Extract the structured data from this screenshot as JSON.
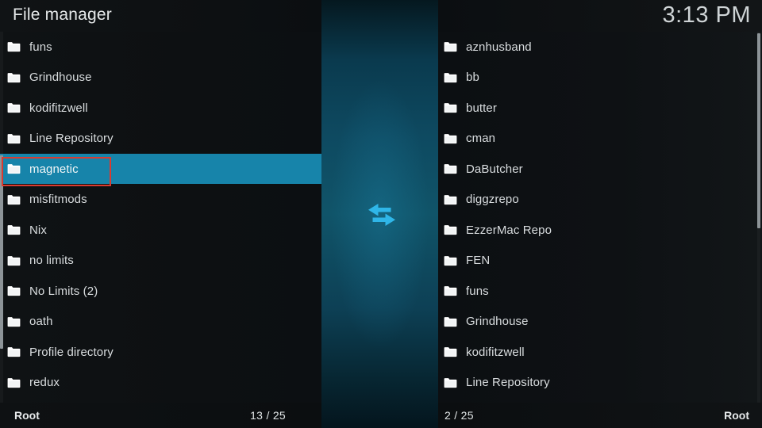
{
  "header": {
    "title": "File manager",
    "clock": "3:13 PM"
  },
  "center": {
    "transfer_icon": "swap-horizontal-arrows-icon",
    "accent_color": "#2eb4e6"
  },
  "theme": {
    "selection_color": "#1784aa",
    "annotation_color": "#d93b30",
    "text_color": "#d9dddf",
    "panel_background": "#0d1012"
  },
  "left_panel": {
    "selected_index": 4,
    "items": [
      {
        "label": "funs",
        "icon": "folder-icon"
      },
      {
        "label": "Grindhouse",
        "icon": "folder-icon"
      },
      {
        "label": "kodifitzwell",
        "icon": "folder-icon"
      },
      {
        "label": "Line Repository",
        "icon": "folder-icon"
      },
      {
        "label": "magnetic",
        "icon": "folder-icon"
      },
      {
        "label": "misfitmods",
        "icon": "folder-icon"
      },
      {
        "label": "Nix",
        "icon": "folder-icon"
      },
      {
        "label": "no limits",
        "icon": "folder-icon"
      },
      {
        "label": "No Limits (2)",
        "icon": "folder-icon"
      },
      {
        "label": "oath",
        "icon": "folder-icon"
      },
      {
        "label": "Profile directory",
        "icon": "folder-icon"
      },
      {
        "label": "redux",
        "icon": "folder-icon"
      }
    ],
    "status": {
      "path": "Root",
      "counter": "13 / 25"
    }
  },
  "right_panel": {
    "selected_index": null,
    "items": [
      {
        "label": "aznhusband",
        "icon": "folder-icon"
      },
      {
        "label": "bb",
        "icon": "folder-icon"
      },
      {
        "label": "butter",
        "icon": "folder-icon"
      },
      {
        "label": "cman",
        "icon": "folder-icon"
      },
      {
        "label": "DaButcher",
        "icon": "folder-icon"
      },
      {
        "label": "diggzrepo",
        "icon": "folder-icon"
      },
      {
        "label": "EzzerMac Repo",
        "icon": "folder-icon"
      },
      {
        "label": "FEN",
        "icon": "folder-icon"
      },
      {
        "label": "funs",
        "icon": "folder-icon"
      },
      {
        "label": "Grindhouse",
        "icon": "folder-icon"
      },
      {
        "label": "kodifitzwell",
        "icon": "folder-icon"
      },
      {
        "label": "Line Repository",
        "icon": "folder-icon"
      }
    ],
    "status": {
      "counter": "2 / 25",
      "path": "Root"
    }
  }
}
